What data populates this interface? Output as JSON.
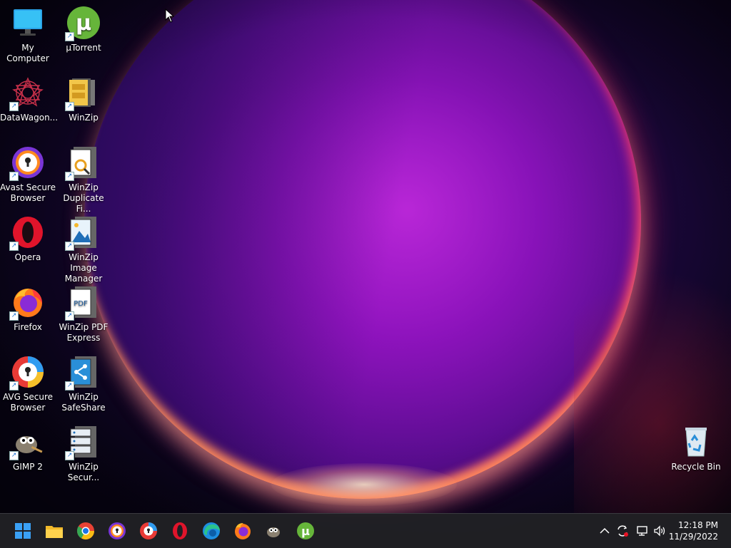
{
  "desktop": {
    "icons": [
      {
        "label": "My Computer"
      },
      {
        "label": "µTorrent"
      },
      {
        "label": "DataWagon..."
      },
      {
        "label": "WinZip"
      },
      {
        "label": "Avast Secure Browser"
      },
      {
        "label": "WinZip Duplicate Fi..."
      },
      {
        "label": "Opera"
      },
      {
        "label": "WinZip Image Manager"
      },
      {
        "label": "Firefox"
      },
      {
        "label": "WinZip PDF Express"
      },
      {
        "label": "AVG Secure Browser"
      },
      {
        "label": "WinZip SafeShare"
      },
      {
        "label": "GIMP 2"
      },
      {
        "label": "WinZip Secur..."
      },
      {
        "label": "Recycle Bin"
      }
    ]
  },
  "taskbar": {
    "pinned": [
      "start-icon",
      "file-explorer-icon",
      "chrome-icon",
      "avast-browser-icon",
      "avg-browser-icon",
      "opera-icon",
      "edge-icon",
      "firefox-icon",
      "gimp-icon",
      "utorrent-icon"
    ],
    "tray_icons": [
      "chevron-up-icon",
      "sync-icon",
      "network-icon",
      "volume-icon"
    ],
    "time": "12:18 PM",
    "date": "11/29/2022"
  },
  "colors": {
    "taskbar_bg": "#202024",
    "wallpaper_accent": "#b424d4"
  }
}
